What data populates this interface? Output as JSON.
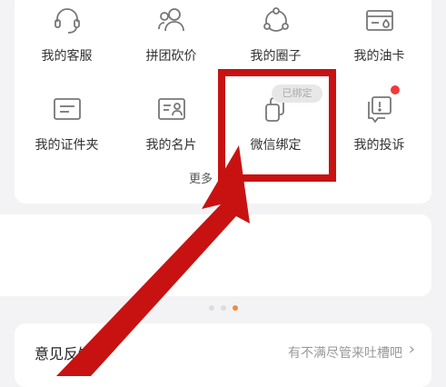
{
  "grid": {
    "items": [
      {
        "label": "我的客服",
        "icon": "headset-icon"
      },
      {
        "label": "拼团砍价",
        "icon": "group-people-icon"
      },
      {
        "label": "我的圈子",
        "icon": "circle-network-icon"
      },
      {
        "label": "我的油卡",
        "icon": "fuel-card-icon"
      },
      {
        "label": "我的证件夹",
        "icon": "id-document-icon"
      },
      {
        "label": "我的名片",
        "icon": "business-card-icon"
      },
      {
        "label": "微信绑定",
        "icon": "wechat-bind-icon"
      },
      {
        "label": "我的投诉",
        "icon": "complaint-icon"
      }
    ],
    "more_label": "更多"
  },
  "wechat": {
    "badge": "已绑定"
  },
  "feedback": {
    "title": "意见反馈",
    "hint": "有不满尽管来吐槽吧",
    "chevron": "›"
  },
  "colors": {
    "accent_dot": "#f08a3c",
    "annotation_red": "#c81212",
    "notification_red": "#f03a3a"
  }
}
